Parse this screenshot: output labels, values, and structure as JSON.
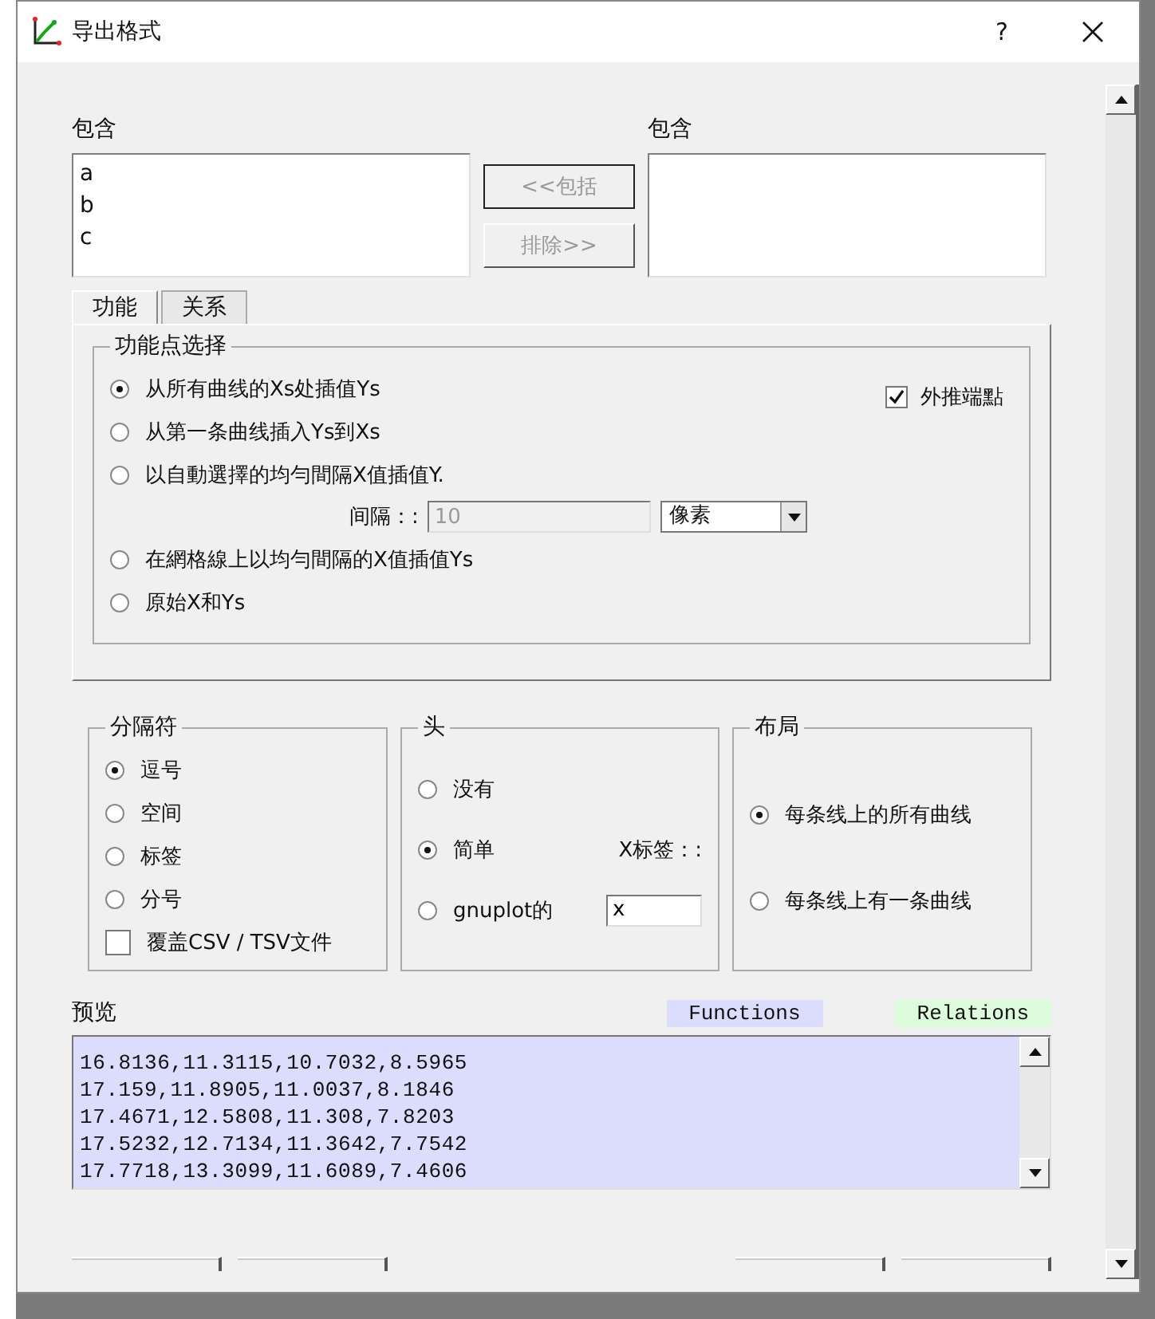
{
  "window": {
    "title": "导出格式",
    "help": "?"
  },
  "include_left": {
    "label": "包含",
    "items": [
      "a",
      "b",
      "c"
    ]
  },
  "include_button": {
    "label": "<<包括",
    "disabled": true
  },
  "exclude_button": {
    "label": "排除>>",
    "disabled": true
  },
  "include_right": {
    "label": "包含"
  },
  "tabs": [
    {
      "label": "功能",
      "selected": true
    },
    {
      "label": "关系",
      "selected": false
    }
  ],
  "point_selection": {
    "title": "功能点选择",
    "extrapolate": {
      "label": "外推端點",
      "checked": true
    },
    "options": [
      {
        "label": "从所有曲线的Xs处插值Ys",
        "selected": true
      },
      {
        "label": "从第一条曲线插入Ys到Xs",
        "selected": false
      },
      {
        "label": "以自動選擇的均勻間隔X值插值Y.",
        "selected": false,
        "interval": {
          "label": "间隔：:",
          "value": "10",
          "disabled": true,
          "unit": "像素"
        }
      },
      {
        "label": "在網格線上以均勻間隔的X值插值Ys",
        "selected": false
      },
      {
        "label": "原始X和Ys",
        "selected": false
      }
    ]
  },
  "separator": {
    "title": "分隔符",
    "options": [
      {
        "label": "逗号",
        "selected": true
      },
      {
        "label": "空间",
        "selected": false
      },
      {
        "label": "标签",
        "selected": false
      },
      {
        "label": "分号",
        "selected": false
      }
    ],
    "overwrite": {
      "label": "覆盖CSV / TSV文件",
      "checked": false
    }
  },
  "header": {
    "title": "头",
    "options": [
      {
        "label": "没有",
        "selected": false
      },
      {
        "label": "简单",
        "selected": true
      },
      {
        "label": "gnuplot的",
        "selected": false
      }
    ],
    "x_label": {
      "label": "X标签：:",
      "value": "x"
    }
  },
  "layout": {
    "title": "布局",
    "options": [
      {
        "label": "每条线上的所有曲线",
        "selected": true
      },
      {
        "label": "每条线上有一条曲线",
        "selected": false
      }
    ]
  },
  "preview": {
    "label": "预览",
    "functions_label": "Functions",
    "relations_label": "Relations",
    "lines": [
      "16.8136,11.3115,10.7032,8.5965",
      "17.159,11.8905,11.0037,8.1846",
      "17.4671,12.5808,11.308,7.8203",
      "17.5232,12.7134,11.3642,7.7542",
      "17.7718,13.3099,11.6089,7.4606"
    ]
  }
}
